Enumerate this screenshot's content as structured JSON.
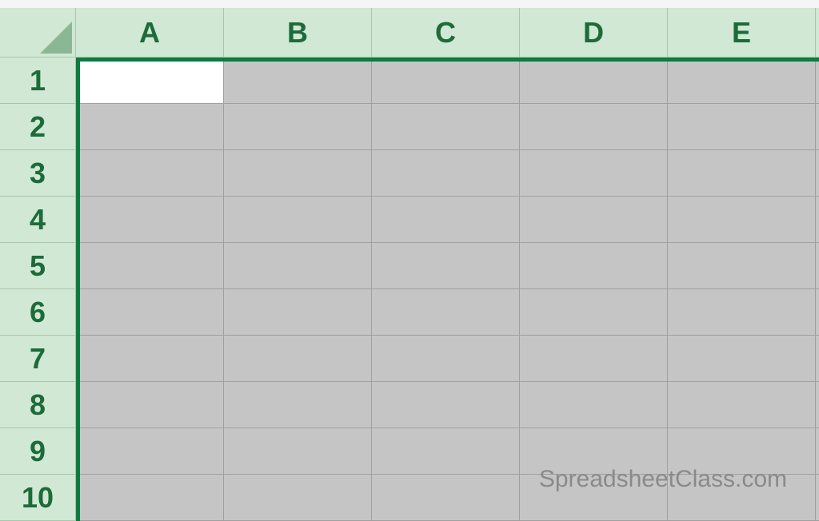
{
  "spreadsheet": {
    "columns": [
      "A",
      "B",
      "C",
      "D",
      "E"
    ],
    "rows": [
      "1",
      "2",
      "3",
      "4",
      "5",
      "6",
      "7",
      "8",
      "9",
      "10"
    ],
    "active_cell": "A1",
    "selection": "all",
    "cells": []
  },
  "watermark": "SpreadsheetClass.com",
  "colors": {
    "header_bg": "#d0e8d4",
    "header_text": "#1d6b3a",
    "selection_border": "#0d7a3e",
    "selected_fill": "#c5c5c5",
    "active_fill": "#ffffff"
  }
}
